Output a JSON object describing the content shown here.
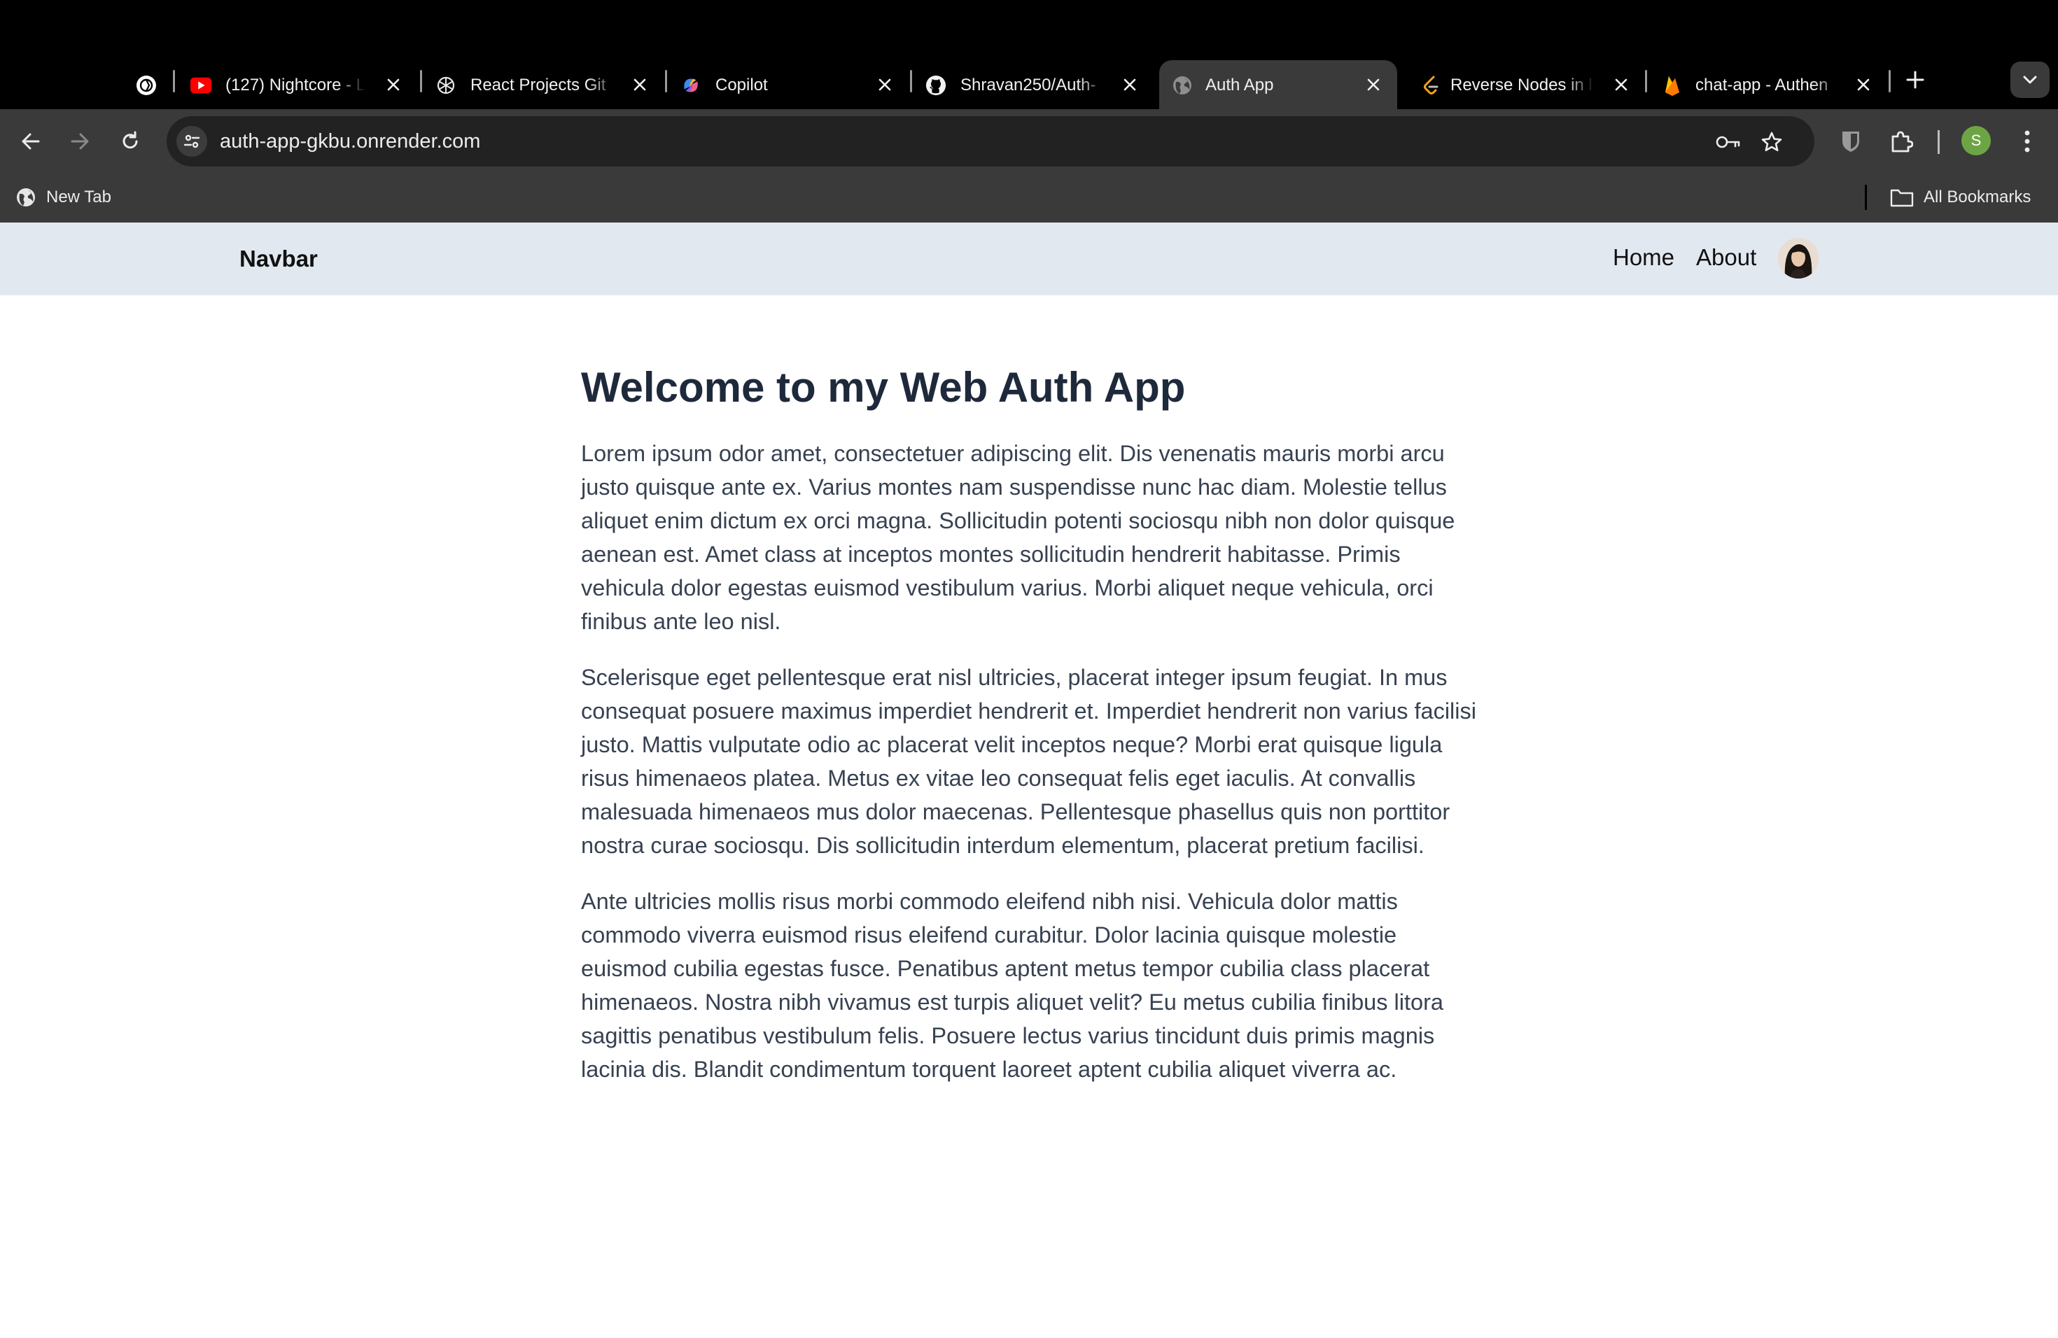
{
  "browser": {
    "tabs": [
      {
        "title": "",
        "icon": "openai-chatgpt-icon",
        "active": false
      },
      {
        "title": "(127) Nightcore - L",
        "icon": "youtube-icon",
        "active": false
      },
      {
        "title": "React Projects Git",
        "icon": "openai-icon",
        "active": false
      },
      {
        "title": "Copilot",
        "icon": "copilot-icon",
        "active": false
      },
      {
        "title": "Shravan250/Auth-",
        "icon": "github-icon",
        "active": false
      },
      {
        "title": "Auth App",
        "icon": "globe-icon",
        "active": true
      },
      {
        "title": "Reverse Nodes in l",
        "icon": "leetcode-icon",
        "active": false
      },
      {
        "title": "chat-app - Authen",
        "icon": "firebase-icon",
        "active": false
      }
    ],
    "url": "auth-app-gkbu.onrender.com",
    "profile_initial": "S",
    "bookmarks": {
      "new_tab": "New Tab",
      "all_bookmarks": "All Bookmarks"
    }
  },
  "navbar": {
    "brand": "Navbar",
    "links": [
      "Home",
      "About"
    ]
  },
  "main": {
    "title": "Welcome to my Web Auth App",
    "paragraphs": [
      "Lorem ipsum odor amet, consectetuer adipiscing elit. Dis venenatis mauris morbi arcu justo quisque ante ex. Varius montes nam suspendisse nunc hac diam. Molestie tellus aliquet enim dictum ex orci magna. Sollicitudin potenti sociosqu nibh non dolor quisque aenean est. Amet class at inceptos montes sollicitudin hendrerit habitasse. Primis vehicula dolor egestas euismod vestibulum varius. Morbi aliquet neque vehicula, orci finibus ante leo nisl.",
      "Scelerisque eget pellentesque erat nisl ultricies, placerat integer ipsum feugiat. In mus consequat posuere maximus imperdiet hendrerit et. Imperdiet hendrerit non varius facilisi justo. Mattis vulputate odio ac placerat velit inceptos neque? Morbi erat quisque ligula risus himenaeos platea. Metus ex vitae leo consequat felis eget iaculis. At convallis malesuada himenaeos mus dolor maecenas. Pellentesque phasellus quis non porttitor nostra curae sociosqu. Dis sollicitudin interdum elementum, placerat pretium facilisi.",
      "Ante ultricies mollis risus morbi commodo eleifend nibh nisi. Vehicula dolor mattis commodo viverra euismod risus eleifend curabitur. Dolor lacinia quisque molestie euismod cubilia egestas fusce. Penatibus aptent metus tempor cubilia class placerat himenaeos. Nostra nibh vivamus est turpis aliquet velit? Eu metus cubilia finibus litora sagittis penatibus vestibulum felis. Posuere lectus varius tincidunt duis primis magnis lacinia dis. Blandit condimentum torquent laoreet aptent cubilia aliquet viverra ac."
    ]
  },
  "colors": {
    "navbar_bg": "#e2e8f0",
    "heading": "#1e293b",
    "body_text": "#374151",
    "chrome_dark": "#3a3a3a"
  }
}
